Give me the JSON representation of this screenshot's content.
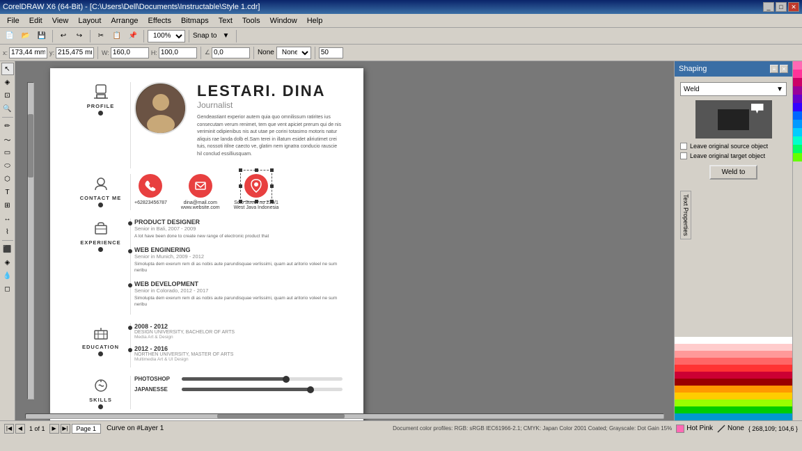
{
  "app": {
    "title": "CorelDRAW X6 (64-Bit) - [C:\\Users\\Dell\\Documents\\Instructable\\Style 1.cdr]",
    "titlebar_buttons": [
      "_",
      "□",
      "✕"
    ]
  },
  "menu": {
    "items": [
      "File",
      "Edit",
      "View",
      "Layout",
      "Arrange",
      "Effects",
      "Bitmaps",
      "Text",
      "Tools",
      "Window",
      "Help"
    ]
  },
  "toolbar": {
    "zoom": "100%",
    "snap_label": "Snap to",
    "coord_x_label": "x:",
    "coord_x_val": "173,44 mm",
    "coord_y_label": "y:",
    "coord_y_val": "215,475 mm",
    "w_val": "160,0",
    "h_val": "100,0",
    "angle_val": "0,0"
  },
  "panels": {
    "shaping": {
      "title": "Shaping",
      "weld_label": "Weld",
      "leave_source": "Leave original source object",
      "leave_target": "Leave original target object",
      "weld_to": "Weld to"
    }
  },
  "resume": {
    "name": "LESTARI. DINA",
    "job_title": "Journalist",
    "bio": "Gendeastiant experior autem quia quo omnilissum ratirites ius consecutam verum renimet, tem que vent apiciet prerum qui de nis veriminit odipienibus nis aut utae pe corini totasimo motoris natur aliquis rae landa dolb el.Sam terei in illatum esidet aliriutimet crei tuis, nossoti itilne caecto ve, glatim nem ignatra conducio rauscie hil conclud essilliusquam.",
    "profile_label": "PROFILE",
    "contact_label": "CONTACT ME",
    "contact_items": [
      {
        "type": "phone",
        "icon": "📞",
        "text": "+62823456787"
      },
      {
        "type": "email",
        "icon": "✉",
        "text": "dina@mail.com\nwww.website.com"
      },
      {
        "type": "location",
        "icon": "📍",
        "text": "Solo Street no 239/1\nWest Java Indonesia"
      }
    ],
    "experience_label": "EXPERIENCE",
    "experience_items": [
      {
        "title": "PRODUCT\nDESIGNER",
        "sub": "Senior in Bali, 2007 - 2009",
        "desc": "A lot have been done to create new range of electronic product that"
      },
      {
        "title": "WEB\nENGINERING",
        "sub": "Senior in Munich, 2009 - 2012",
        "desc": "Simolupta dem exerum rem di as nobis aute parundisquae verlissimi, quam aut aritorio voleel ne sum neribu"
      },
      {
        "title": "WEB\nDEVELOPMENT",
        "sub": "Senior in Colorado, 2012 - 2017",
        "desc": "Simolupta dem exerum rem di as nobis aute parundisquae verlissimi, quam aut aritorio voleel ne sum neribu"
      }
    ],
    "education_label": "EDUCATION",
    "education_items": [
      {
        "year": "2008 - 2012",
        "name": "DESIGN UNIVERSITY, BACHELOR OF ARTS",
        "sub": "Media Art & Design"
      },
      {
        "year": "2012 - 2016",
        "name": "NORTHEN UNIVERSITY, MASTER OF ARTS",
        "sub": "Multimedia Art & UI Design"
      }
    ],
    "skills_label": "SKILLS",
    "skills_items": [
      {
        "label": "PHOTOSHOP",
        "pct": 65
      },
      {
        "label": "JAPANESSE",
        "pct": 80
      }
    ]
  },
  "statusbar": {
    "page_info": "1 of 1",
    "page_name": "Page 1",
    "curve_info": "Curve on #Layer 1",
    "color_mode": "Document color profiles: RGB: sRGB IEC61966-2.1; CMYK: Japan Color 2001 Coated; Grayscale: Dot Gain 15%",
    "fill_label": "Hot Pink",
    "outline_label": "None",
    "coords": "{ 268,109; 104,6 }"
  },
  "colors": {
    "accent_red": "#e84040",
    "dark": "#333333",
    "light_bg": "#d4d0c8"
  }
}
